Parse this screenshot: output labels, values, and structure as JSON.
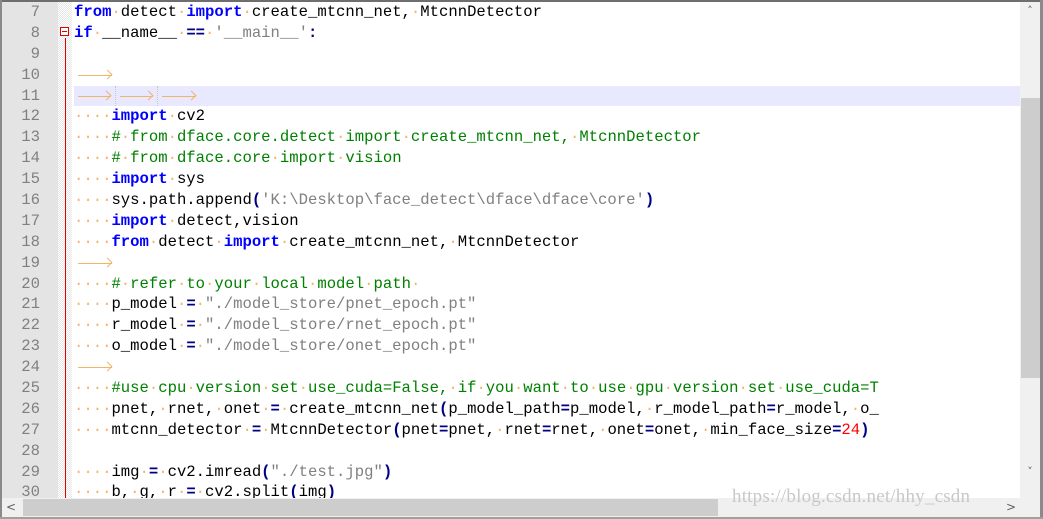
{
  "editor": {
    "current_line": 11,
    "lines": [
      {
        "no": "7",
        "tokens": [
          [
            "kw",
            "from"
          ],
          [
            "ws",
            "·"
          ],
          [
            "",
            "detect"
          ],
          [
            "ws",
            "·"
          ],
          [
            "kw",
            "import"
          ],
          [
            "ws",
            "·"
          ],
          [
            "",
            "create_mtcnn_net,"
          ],
          [
            "ws",
            "·"
          ],
          [
            "",
            "MtcnnDetector"
          ]
        ]
      },
      {
        "no": "8",
        "tokens": [
          [
            "kw",
            "if"
          ],
          [
            "ws",
            "·"
          ],
          [
            "",
            "__name__"
          ],
          [
            "ws",
            "·"
          ],
          [
            "op",
            "=="
          ],
          [
            "ws",
            "·"
          ],
          [
            "st",
            "'__main__'"
          ],
          [
            "op",
            ":"
          ]
        ]
      },
      {
        "no": "9",
        "tokens": []
      },
      {
        "no": "10",
        "tokens": [
          [
            "tab",
            ""
          ]
        ]
      },
      {
        "no": "11",
        "tokens": [
          [
            "tabsep",
            ""
          ],
          [
            "tabsep",
            ""
          ],
          [
            "tab",
            ""
          ]
        ]
      },
      {
        "no": "12",
        "tokens": [
          [
            "ws",
            "····"
          ],
          [
            "kw",
            "import"
          ],
          [
            "ws",
            "·"
          ],
          [
            "",
            "cv2"
          ]
        ]
      },
      {
        "no": "13",
        "tokens": [
          [
            "ws",
            "····"
          ],
          [
            "cm",
            "#"
          ],
          [
            "ws",
            "·"
          ],
          [
            "cm",
            "from"
          ],
          [
            "ws",
            "·"
          ],
          [
            "cm",
            "dface.core.detect"
          ],
          [
            "ws",
            "·"
          ],
          [
            "cm",
            "import"
          ],
          [
            "ws",
            "·"
          ],
          [
            "cm",
            "create_mtcnn_net,"
          ],
          [
            "ws",
            "·"
          ],
          [
            "cm",
            "MtcnnDetector"
          ]
        ]
      },
      {
        "no": "14",
        "tokens": [
          [
            "ws",
            "····"
          ],
          [
            "cm",
            "#"
          ],
          [
            "ws",
            "·"
          ],
          [
            "cm",
            "from"
          ],
          [
            "ws",
            "·"
          ],
          [
            "cm",
            "dface.core"
          ],
          [
            "ws",
            "·"
          ],
          [
            "cm",
            "import"
          ],
          [
            "ws",
            "·"
          ],
          [
            "cm",
            "vision"
          ]
        ]
      },
      {
        "no": "15",
        "tokens": [
          [
            "ws",
            "····"
          ],
          [
            "kw",
            "import"
          ],
          [
            "ws",
            "·"
          ],
          [
            "",
            "sys"
          ]
        ]
      },
      {
        "no": "16",
        "tokens": [
          [
            "ws",
            "····"
          ],
          [
            "",
            "sys.path.append"
          ],
          [
            "op",
            "("
          ],
          [
            "st",
            "'K:\\Desktop\\face_detect\\dface\\dface\\core'"
          ],
          [
            "op",
            ")"
          ]
        ]
      },
      {
        "no": "17",
        "tokens": [
          [
            "ws",
            "····"
          ],
          [
            "kw",
            "import"
          ],
          [
            "ws",
            "·"
          ],
          [
            "",
            "detect,vision"
          ]
        ]
      },
      {
        "no": "18",
        "tokens": [
          [
            "ws",
            "····"
          ],
          [
            "kw",
            "from"
          ],
          [
            "ws",
            "·"
          ],
          [
            "",
            "detect"
          ],
          [
            "ws",
            "·"
          ],
          [
            "kw",
            "import"
          ],
          [
            "ws",
            "·"
          ],
          [
            "",
            "create_mtcnn_net,"
          ],
          [
            "ws",
            "·"
          ],
          [
            "",
            "MtcnnDetector"
          ]
        ]
      },
      {
        "no": "19",
        "tokens": [
          [
            "tab",
            ""
          ]
        ]
      },
      {
        "no": "20",
        "tokens": [
          [
            "ws",
            "····"
          ],
          [
            "cm",
            "#"
          ],
          [
            "ws",
            "·"
          ],
          [
            "cm",
            "refer"
          ],
          [
            "ws",
            "·"
          ],
          [
            "cm",
            "to"
          ],
          [
            "ws",
            "·"
          ],
          [
            "cm",
            "your"
          ],
          [
            "ws",
            "·"
          ],
          [
            "cm",
            "local"
          ],
          [
            "ws",
            "·"
          ],
          [
            "cm",
            "model"
          ],
          [
            "ws",
            "·"
          ],
          [
            "cm",
            "path"
          ],
          [
            "ws",
            "·"
          ]
        ]
      },
      {
        "no": "21",
        "tokens": [
          [
            "ws",
            "····"
          ],
          [
            "",
            "p_model"
          ],
          [
            "ws",
            "·"
          ],
          [
            "op",
            "="
          ],
          [
            "ws",
            "·"
          ],
          [
            "st",
            "\"./model_store/pnet_epoch.pt\""
          ]
        ]
      },
      {
        "no": "22",
        "tokens": [
          [
            "ws",
            "····"
          ],
          [
            "",
            "r_model"
          ],
          [
            "ws",
            "·"
          ],
          [
            "op",
            "="
          ],
          [
            "ws",
            "·"
          ],
          [
            "st",
            "\"./model_store/rnet_epoch.pt\""
          ]
        ]
      },
      {
        "no": "23",
        "tokens": [
          [
            "ws",
            "····"
          ],
          [
            "",
            "o_model"
          ],
          [
            "ws",
            "·"
          ],
          [
            "op",
            "="
          ],
          [
            "ws",
            "·"
          ],
          [
            "st",
            "\"./model_store/onet_epoch.pt\""
          ]
        ]
      },
      {
        "no": "24",
        "tokens": [
          [
            "tab",
            ""
          ]
        ]
      },
      {
        "no": "25",
        "tokens": [
          [
            "ws",
            "····"
          ],
          [
            "cm",
            "#use"
          ],
          [
            "ws",
            "·"
          ],
          [
            "cm",
            "cpu"
          ],
          [
            "ws",
            "·"
          ],
          [
            "cm",
            "version"
          ],
          [
            "ws",
            "·"
          ],
          [
            "cm",
            "set"
          ],
          [
            "ws",
            "·"
          ],
          [
            "cm",
            "use_cuda=False,"
          ],
          [
            "ws",
            "·"
          ],
          [
            "cm",
            "if"
          ],
          [
            "ws",
            "·"
          ],
          [
            "cm",
            "you"
          ],
          [
            "ws",
            "·"
          ],
          [
            "cm",
            "want"
          ],
          [
            "ws",
            "·"
          ],
          [
            "cm",
            "to"
          ],
          [
            "ws",
            "·"
          ],
          [
            "cm",
            "use"
          ],
          [
            "ws",
            "·"
          ],
          [
            "cm",
            "gpu"
          ],
          [
            "ws",
            "·"
          ],
          [
            "cm",
            "version"
          ],
          [
            "ws",
            "·"
          ],
          [
            "cm",
            "set"
          ],
          [
            "ws",
            "·"
          ],
          [
            "cm",
            "use_cuda=T"
          ]
        ]
      },
      {
        "no": "26",
        "tokens": [
          [
            "ws",
            "····"
          ],
          [
            "",
            "pnet,"
          ],
          [
            "ws",
            "·"
          ],
          [
            "",
            "rnet,"
          ],
          [
            "ws",
            "·"
          ],
          [
            "",
            "onet"
          ],
          [
            "ws",
            "·"
          ],
          [
            "op",
            "="
          ],
          [
            "ws",
            "·"
          ],
          [
            "",
            "create_mtcnn_net"
          ],
          [
            "op",
            "("
          ],
          [
            "",
            "p_model_path"
          ],
          [
            "op",
            "="
          ],
          [
            "",
            "p_model,"
          ],
          [
            "ws",
            "·"
          ],
          [
            "",
            "r_model_path"
          ],
          [
            "op",
            "="
          ],
          [
            "",
            "r_model,"
          ],
          [
            "ws",
            "·"
          ],
          [
            "",
            "o_"
          ]
        ]
      },
      {
        "no": "27",
        "tokens": [
          [
            "ws",
            "····"
          ],
          [
            "",
            "mtcnn_detector"
          ],
          [
            "ws",
            "·"
          ],
          [
            "op",
            "="
          ],
          [
            "ws",
            "·"
          ],
          [
            "",
            "MtcnnDetector"
          ],
          [
            "op",
            "("
          ],
          [
            "",
            "pnet"
          ],
          [
            "op",
            "="
          ],
          [
            "",
            "pnet,"
          ],
          [
            "ws",
            "·"
          ],
          [
            "",
            "rnet"
          ],
          [
            "op",
            "="
          ],
          [
            "",
            "rnet,"
          ],
          [
            "ws",
            "·"
          ],
          [
            "",
            "onet"
          ],
          [
            "op",
            "="
          ],
          [
            "",
            "onet,"
          ],
          [
            "ws",
            "·"
          ],
          [
            "",
            "min_face_size"
          ],
          [
            "op",
            "="
          ],
          [
            "num",
            "24"
          ],
          [
            "op",
            ")"
          ]
        ]
      },
      {
        "no": "28",
        "tokens": []
      },
      {
        "no": "29",
        "tokens": [
          [
            "ws",
            "····"
          ],
          [
            "",
            "img"
          ],
          [
            "ws",
            "·"
          ],
          [
            "op",
            "="
          ],
          [
            "ws",
            "·"
          ],
          [
            "",
            "cv2.imread"
          ],
          [
            "op",
            "("
          ],
          [
            "st",
            "\"./test.jpg\""
          ],
          [
            "op",
            ")"
          ]
        ]
      },
      {
        "no": "30",
        "tokens": [
          [
            "ws",
            "····"
          ],
          [
            "",
            "b,"
          ],
          [
            "ws",
            "·"
          ],
          [
            "",
            "g,"
          ],
          [
            "ws",
            "·"
          ],
          [
            "",
            "r"
          ],
          [
            "ws",
            "·"
          ],
          [
            "op",
            "="
          ],
          [
            "ws",
            "·"
          ],
          [
            "",
            "cv2.split"
          ],
          [
            "op",
            "("
          ],
          [
            "",
            "img"
          ],
          [
            "op",
            ")"
          ]
        ]
      }
    ]
  },
  "scrollbars": {
    "vertical": {
      "up_icon": "˄",
      "down_icon": "˅"
    },
    "horizontal": {
      "left_icon": "<",
      "right_icon": ">"
    }
  },
  "watermark": "https://blog.csdn.net/hhy_csdn",
  "colors": {
    "keyword": "#0000ff",
    "comment": "#008000",
    "string": "#808080",
    "operator": "#000080",
    "number": "#ff0000",
    "whitespace_marker": "#f2b469",
    "current_line_bg": "#e8e8ff",
    "fold_marker": "#e00000"
  }
}
